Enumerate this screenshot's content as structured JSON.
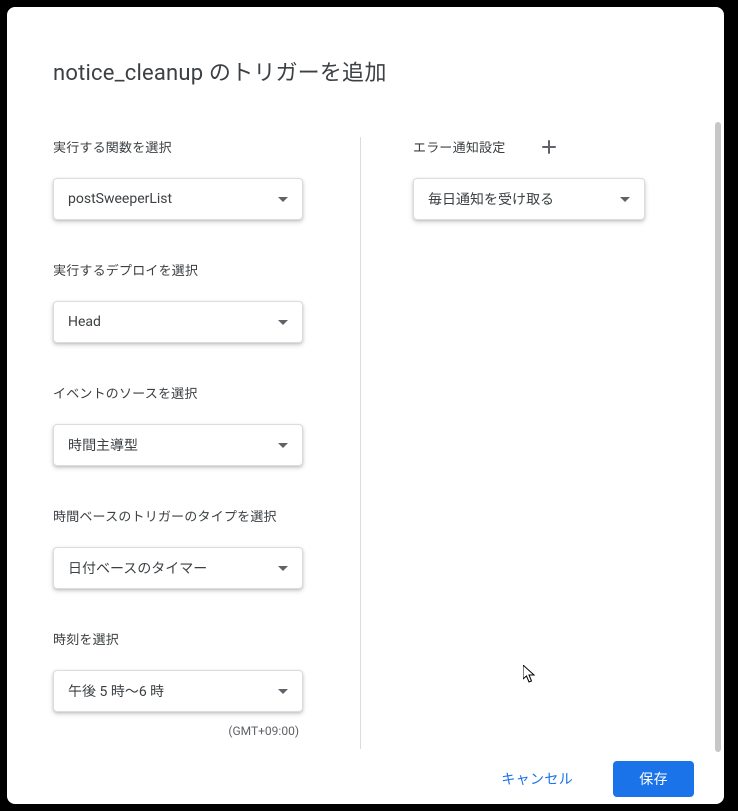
{
  "dialog": {
    "title": "notice_cleanup のトリガーを追加"
  },
  "left": {
    "function_label": "実行する関数を選択",
    "function_value": "postSweeperList",
    "deploy_label": "実行するデプロイを選択",
    "deploy_value": "Head",
    "event_source_label": "イベントのソースを選択",
    "event_source_value": "時間主導型",
    "trigger_type_label": "時間ベースのトリガーのタイプを選択",
    "trigger_type_value": "日付ベースのタイマー",
    "time_label": "時刻を選択",
    "time_value": "午後 5 時～6 時",
    "timezone": "(GMT+09:00)"
  },
  "right": {
    "error_label": "エラー通知設定",
    "error_value": "毎日通知を受け取る"
  },
  "footer": {
    "cancel": "キャンセル",
    "save": "保存"
  }
}
